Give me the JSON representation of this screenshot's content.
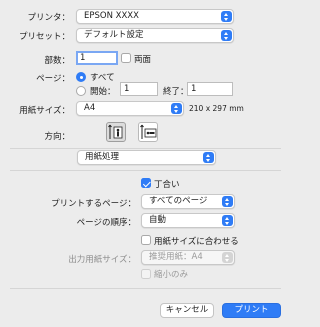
{
  "printer": {
    "label": "プリンタ：",
    "value": "EPSON XXXX"
  },
  "preset": {
    "label": "プリセット：",
    "value": "デフォルト設定"
  },
  "copies": {
    "label": "部数：",
    "value": "1",
    "two_sided_label": "両面",
    "two_sided_checked": false
  },
  "pages": {
    "label": "ページ：",
    "all_label": "すべて",
    "range_label": "開始：",
    "from_value": "1",
    "to_label": "終了：",
    "to_value": "1",
    "selected": "all"
  },
  "paper_size": {
    "label": "用紙サイズ：",
    "value": "A4",
    "dimensions": "210 x 297 mm"
  },
  "orientation": {
    "label": "方向：",
    "selected": "portrait"
  },
  "section_popup": {
    "value": "用紙処理"
  },
  "collate": {
    "label": "丁合い",
    "checked": true
  },
  "pages_to_print": {
    "label": "プリントするページ：",
    "value": "すべてのページ"
  },
  "page_order": {
    "label": "ページの順序：",
    "value": "自動"
  },
  "scale_to_fit": {
    "label": "用紙サイズに合わせる",
    "checked": false
  },
  "output_paper_size": {
    "label": "出力用紙サイズ：",
    "value": "推奨用紙：A4",
    "enabled": false
  },
  "scale_down_only": {
    "label": "縮小のみ",
    "checked": false,
    "enabled": false
  },
  "buttons": {
    "cancel": "キャンセル",
    "print": "プリント"
  },
  "colors": {
    "accent": "#2f7cf6",
    "background": "#ececec"
  }
}
